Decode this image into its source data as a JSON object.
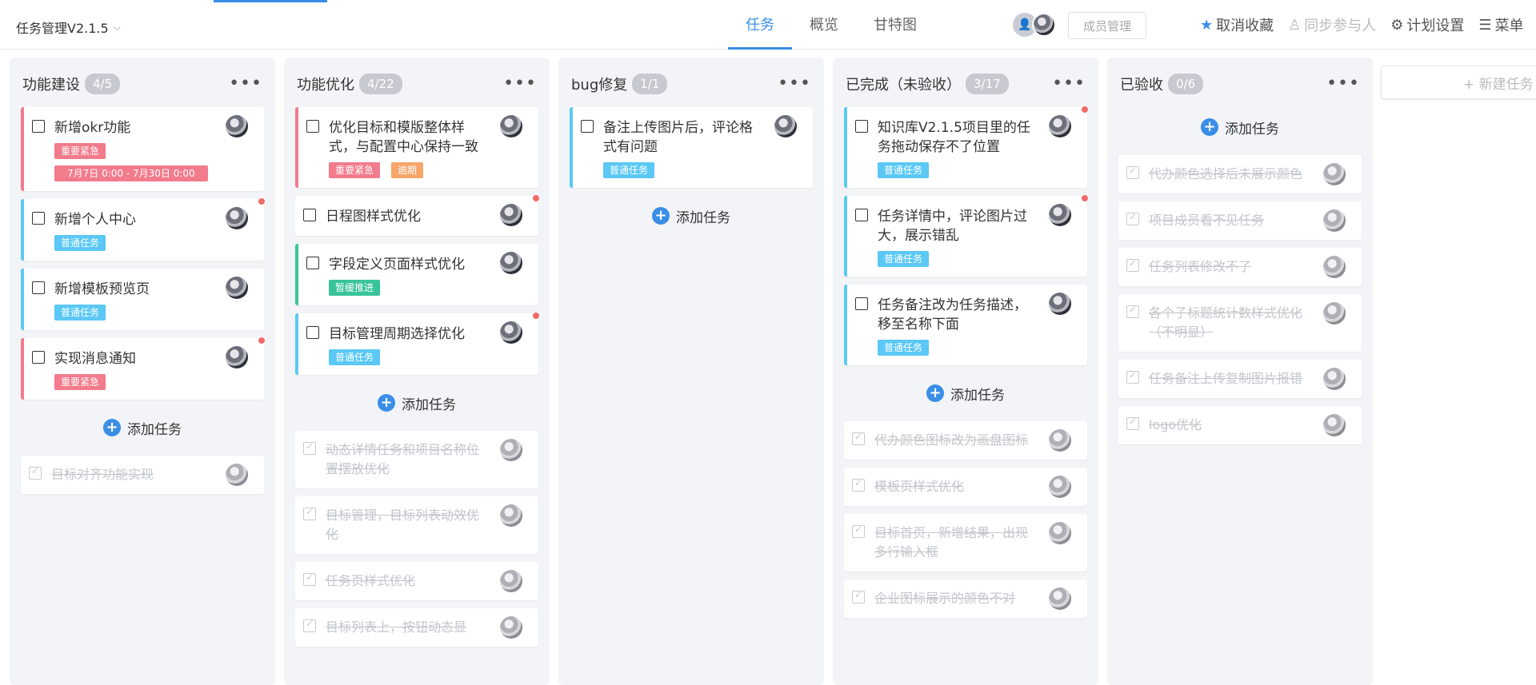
{
  "header": {
    "project_title": "任务管理V2.1.5",
    "tabs": [
      {
        "label": "任务",
        "active": true
      },
      {
        "label": "概览",
        "active": false
      },
      {
        "label": "甘特图",
        "active": false
      }
    ],
    "member_button": "成员管理",
    "actions": {
      "unfavorite": "取消收藏",
      "sync_participants": "同步参与人",
      "plan_settings": "计划设置",
      "menu": "菜单"
    }
  },
  "columns": [
    {
      "title": "功能建设",
      "count": "4/5",
      "open_cards": [
        {
          "title": "新增okr功能",
          "stripe": "red",
          "dot": false,
          "tags": [
            {
              "label": "重要紧急",
              "kind": "urgent"
            },
            {
              "label": "7月7日 0:00 - 7月30日 0:00",
              "kind": "date"
            }
          ]
        },
        {
          "title": "新增个人中心",
          "stripe": "blue",
          "dot": true,
          "tags": [
            {
              "label": "普通任务",
              "kind": "normal"
            }
          ]
        },
        {
          "title": "新增模板预览页",
          "stripe": "blue",
          "dot": false,
          "tags": [
            {
              "label": "普通任务",
              "kind": "normal"
            }
          ]
        },
        {
          "title": "实现消息通知",
          "stripe": "red",
          "dot": true,
          "tags": [
            {
              "label": "重要紧急",
              "kind": "urgent"
            }
          ]
        }
      ],
      "add_label": "添加任务",
      "done_cards": [
        {
          "title": "目标对齐功能实现"
        }
      ]
    },
    {
      "title": "功能优化",
      "count": "4/22",
      "open_cards": [
        {
          "title": "优化目标和模版整体样式，与配置中心保持一致",
          "stripe": "red",
          "dot": false,
          "tags": [
            {
              "label": "重要紧急",
              "kind": "urgent"
            },
            {
              "label": "逾期",
              "kind": "overdue"
            }
          ]
        },
        {
          "title": "日程图样式优化",
          "stripe": "none",
          "dot": true,
          "tags": []
        },
        {
          "title": "字段定义页面样式优化",
          "stripe": "green",
          "dot": false,
          "tags": [
            {
              "label": "暂缓推进",
              "kind": "slow"
            }
          ]
        },
        {
          "title": "目标管理周期选择优化",
          "stripe": "blue",
          "dot": true,
          "tags": [
            {
              "label": "普通任务",
              "kind": "normal"
            }
          ]
        }
      ],
      "add_label": "添加任务",
      "done_cards": [
        {
          "title": "动态详情任务和项目名称位置摆放优化"
        },
        {
          "title": "目标管理，目标列表动效优化"
        },
        {
          "title": "任务页样式优化"
        },
        {
          "title": "目标列表上，按钮动态显"
        }
      ]
    },
    {
      "title": "bug修复",
      "count": "1/1",
      "open_cards": [
        {
          "title": "备注上传图片后，评论格式有问题",
          "stripe": "blue",
          "dot": false,
          "tags": [
            {
              "label": "普通任务",
              "kind": "normal"
            }
          ]
        }
      ],
      "add_label": "添加任务",
      "done_cards": []
    },
    {
      "title": "已完成（未验收）",
      "count": "3/17",
      "open_cards": [
        {
          "title": "知识库V2.1.5项目里的任务拖动保存不了位置",
          "stripe": "blue",
          "dot": true,
          "tags": [
            {
              "label": "普通任务",
              "kind": "normal"
            }
          ]
        },
        {
          "title": "任务详情中，评论图片过大，展示错乱",
          "stripe": "blue",
          "dot": true,
          "tags": [
            {
              "label": "普通任务",
              "kind": "normal"
            }
          ]
        },
        {
          "title": "任务备注改为任务描述，移至名称下面",
          "stripe": "blue",
          "dot": false,
          "tags": [
            {
              "label": "普通任务",
              "kind": "normal"
            }
          ]
        }
      ],
      "add_label": "添加任务",
      "done_cards": [
        {
          "title": "代办颜色图标改为画盘图标"
        },
        {
          "title": "模板页样式优化"
        },
        {
          "title": "目标首页，新增结果，出现多行输入框"
        },
        {
          "title": "企业图标展示的颜色不对"
        }
      ]
    },
    {
      "title": "已验收",
      "count": "0/6",
      "open_cards": [],
      "add_label": "添加任务",
      "add_first": true,
      "done_cards": [
        {
          "title": "代办颜色选择后未展示颜色"
        },
        {
          "title": "项目成员看不见任务"
        },
        {
          "title": "任务列表修改不了"
        },
        {
          "title": "各个子标题统计数样式优化（不明显）"
        },
        {
          "title": "任务备注上传复制图片报错"
        },
        {
          "title": "logo优化"
        }
      ]
    }
  ],
  "new_task_column_label": "+ 新建任务",
  "colors": {
    "accent": "#3a8ee6",
    "urgent": "#f27b8c",
    "normal": "#5bc8f5",
    "slow": "#39c49a",
    "overdue": "#f7a56a"
  }
}
